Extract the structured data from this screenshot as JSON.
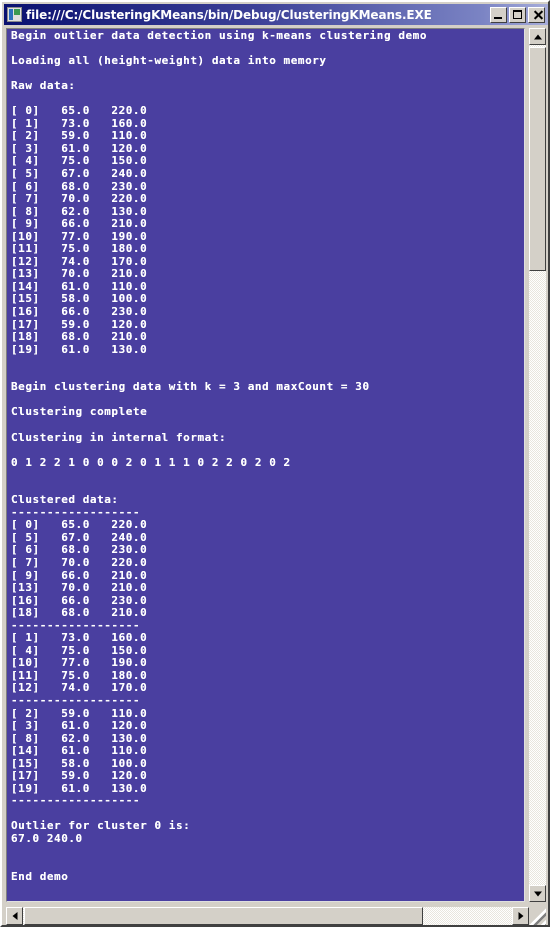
{
  "window": {
    "title": "file:///C:/ClusteringKMeans/bin/Debug/ClusteringKMeans.EXE",
    "icon": "console-window-icon",
    "background_color": "#4a3fa0",
    "text_color": "#ffffff",
    "cursor_color": "#c6d42a",
    "controls": {
      "minimize": "Minimize",
      "maximize": "Maximize",
      "close": "Close"
    }
  },
  "console": {
    "lines": [
      "Begin outlier data detection using k-means clustering demo",
      "",
      "Loading all (height-weight) data into memory",
      "",
      "Raw data:",
      "",
      "[ 0]   65.0   220.0",
      "[ 1]   73.0   160.0",
      "[ 2]   59.0   110.0",
      "[ 3]   61.0   120.0",
      "[ 4]   75.0   150.0",
      "[ 5]   67.0   240.0",
      "[ 6]   68.0   230.0",
      "[ 7]   70.0   220.0",
      "[ 8]   62.0   130.0",
      "[ 9]   66.0   210.0",
      "[10]   77.0   190.0",
      "[11]   75.0   180.0",
      "[12]   74.0   170.0",
      "[13]   70.0   210.0",
      "[14]   61.0   110.0",
      "[15]   58.0   100.0",
      "[16]   66.0   230.0",
      "[17]   59.0   120.0",
      "[18]   68.0   210.0",
      "[19]   61.0   130.0",
      "",
      "",
      "Begin clustering data with k = 3 and maxCount = 30",
      "",
      "Clustering complete",
      "",
      "Clustering in internal format:",
      "",
      "0 1 2 2 1 0 0 0 2 0 1 1 1 0 2 2 0 2 0 2",
      "",
      "",
      "Clustered data:",
      "==================",
      "[ 0]   65.0   220.0",
      "[ 5]   67.0   240.0",
      "[ 6]   68.0   230.0",
      "[ 7]   70.0   220.0",
      "[ 9]   66.0   210.0",
      "[13]   70.0   210.0",
      "[16]   66.0   230.0",
      "[18]   68.0   210.0",
      "==================",
      "[ 1]   73.0   160.0",
      "[ 4]   75.0   150.0",
      "[10]   77.0   190.0",
      "[11]   75.0   180.0",
      "[12]   74.0   170.0",
      "==================",
      "[ 2]   59.0   110.0",
      "[ 3]   61.0   120.0",
      "[ 8]   62.0   130.0",
      "[14]   61.0   110.0",
      "[15]   58.0   100.0",
      "[17]   59.0   120.0",
      "[19]   61.0   130.0",
      "==================",
      "",
      "Outlier for cluster 0 is:",
      "67.0 240.0",
      "",
      "",
      "End demo"
    ]
  },
  "scrollbars": {
    "vertical": {
      "up_arrow": "scroll-up",
      "down_arrow": "scroll-down",
      "thumb": "vertical-thumb"
    },
    "horizontal": {
      "left_arrow": "scroll-left",
      "right_arrow": "scroll-right",
      "thumb": "horizontal-thumb"
    },
    "resize_grip": "resize-grip"
  }
}
